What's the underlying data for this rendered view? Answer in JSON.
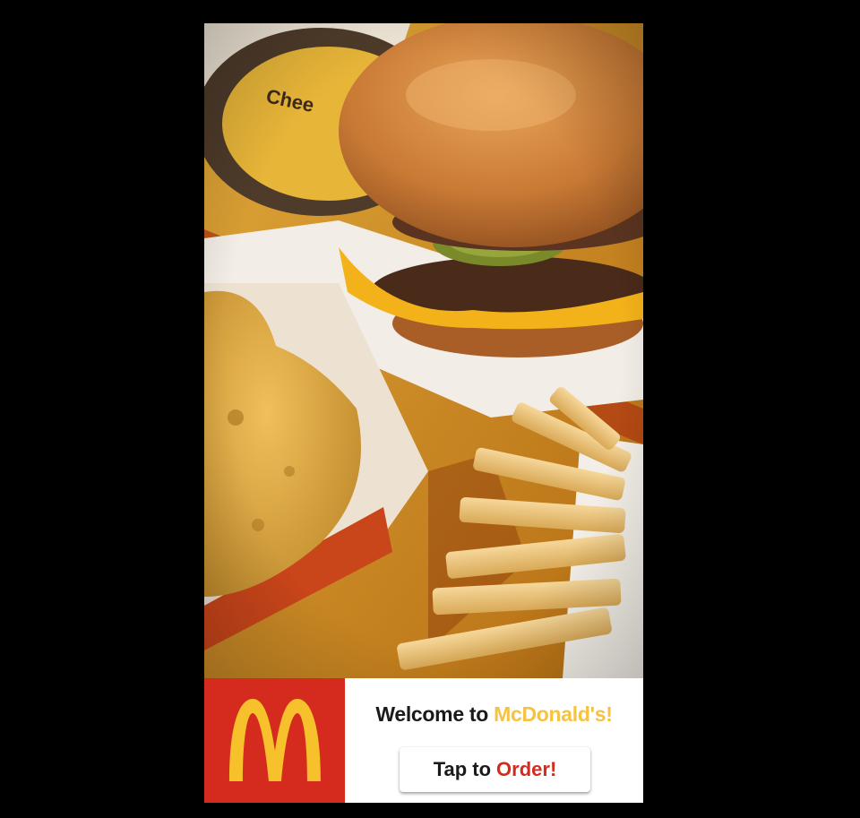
{
  "hero": {
    "image_alt": "Burger, hash brown and fries"
  },
  "logo": {
    "icon": "golden-arches-icon",
    "background": "#d52b1e",
    "arch_color": "#f6c12a"
  },
  "welcome": {
    "prefix": "Welcome to",
    "brand": "McDonald's!",
    "brand_color": "#f5c242"
  },
  "order_button": {
    "prefix": "Tap to",
    "action": "Order!",
    "action_color": "#d52b1e"
  }
}
